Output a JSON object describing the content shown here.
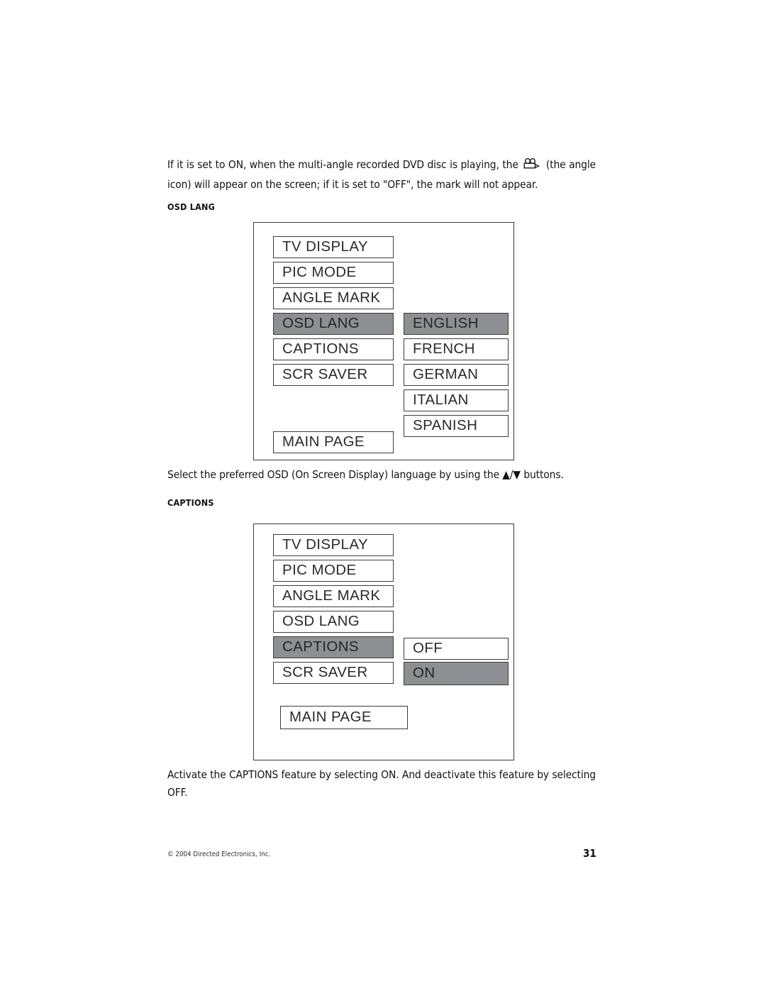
{
  "page": {
    "number": "31",
    "copyright": "© 2004  Directed Electronics, Inc."
  },
  "intro_paragraph": {
    "text_before_icon": "If it is set to ON, when the multi-angle recorded DVD disc is playing, the",
    "icon": "movie-camera-angle-icon",
    "text_after_icon": "(the angle icon) will appear on the screen; if it is set to \"OFF\", the mark will not appear."
  },
  "sections": [
    {
      "heading": "OSD LANG",
      "caption": "Select the preferred OSD (On Screen Display) language by using the ▲/▼ buttons.",
      "menu": {
        "items": [
          {
            "label": "TV DISPLAY",
            "selected": false
          },
          {
            "label": "PIC MODE",
            "selected": false
          },
          {
            "label": "ANGLE MARK",
            "selected": false
          },
          {
            "label": "OSD LANG",
            "selected": true
          },
          {
            "label": "CAPTIONS",
            "selected": false
          },
          {
            "label": "SCR SAVER",
            "selected": false
          }
        ],
        "main_page_label": "MAIN PAGE",
        "submenu": [
          {
            "label": "ENGLISH",
            "selected": true
          },
          {
            "label": "FRENCH",
            "selected": false
          },
          {
            "label": "GERMAN",
            "selected": false
          },
          {
            "label": "ITALIAN",
            "selected": false
          },
          {
            "label": "SPANISH",
            "selected": false
          }
        ]
      }
    },
    {
      "heading": "CAPTIONS",
      "caption": "Activate the CAPTIONS feature by selecting ON. And deactivate this feature by selecting OFF.",
      "menu": {
        "items": [
          {
            "label": "TV DISPLAY",
            "selected": false
          },
          {
            "label": "PIC MODE",
            "selected": false
          },
          {
            "label": "ANGLE MARK",
            "selected": false
          },
          {
            "label": "OSD LANG",
            "selected": false
          },
          {
            "label": "CAPTIONS",
            "selected": true
          },
          {
            "label": "SCR SAVER",
            "selected": false
          }
        ],
        "main_page_label": "MAIN PAGE",
        "submenu": [
          {
            "label": "OFF",
            "selected": false
          },
          {
            "label": "ON",
            "selected": true
          }
        ]
      }
    }
  ],
  "colors": {
    "selection_gray": "#8e8f92",
    "border": "#3c3c3c",
    "text": "#2b2b2b"
  }
}
